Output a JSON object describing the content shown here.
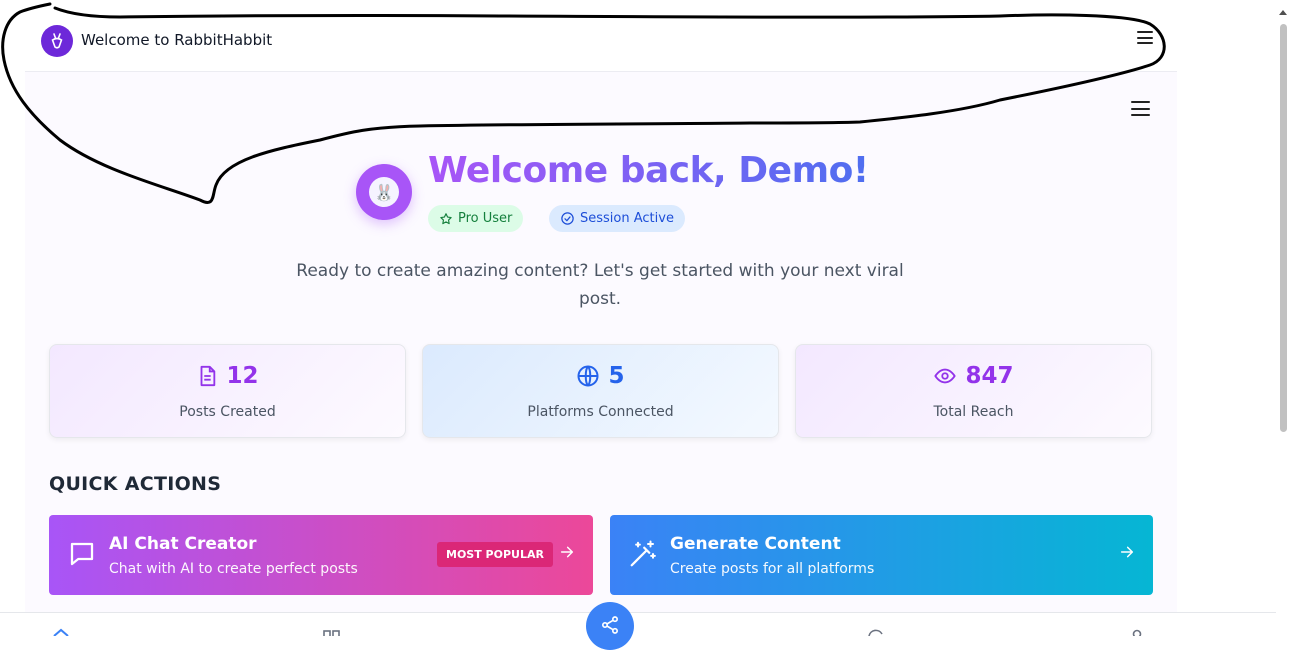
{
  "header": {
    "brand": "Welcome to RabbitHabbit"
  },
  "hero": {
    "greeting": "Welcome back, Demo!",
    "badges": [
      {
        "label": "Pro User",
        "icon": "star-icon"
      },
      {
        "label": "Session Active",
        "icon": "check-circle-icon"
      }
    ],
    "subtitle": "Ready to create amazing content? Let's get started with your next viral post."
  },
  "stats": [
    {
      "value": "12",
      "label": "Posts Created",
      "icon": "document-icon",
      "color": "#9333ea"
    },
    {
      "value": "5",
      "label": "Platforms Connected",
      "icon": "globe-icon",
      "color": "#2563eb"
    },
    {
      "value": "847",
      "label": "Total Reach",
      "icon": "eye-icon",
      "color": "#9333ea"
    }
  ],
  "quick_actions": {
    "title": "QUICK ACTIONS",
    "items": [
      {
        "title": "AI Chat Creator",
        "desc": "Chat with AI to create perfect posts",
        "badge": "MOST POPULAR",
        "icon": "chat-icon"
      },
      {
        "title": "Generate Content",
        "desc": "Create posts for all platforms",
        "icon": "magic-wand-icon"
      }
    ]
  },
  "colors": {
    "brand_purple": "#6d28d9",
    "accent_gradient_start": "#a855f7",
    "accent_gradient_end": "#4f6ef0"
  }
}
